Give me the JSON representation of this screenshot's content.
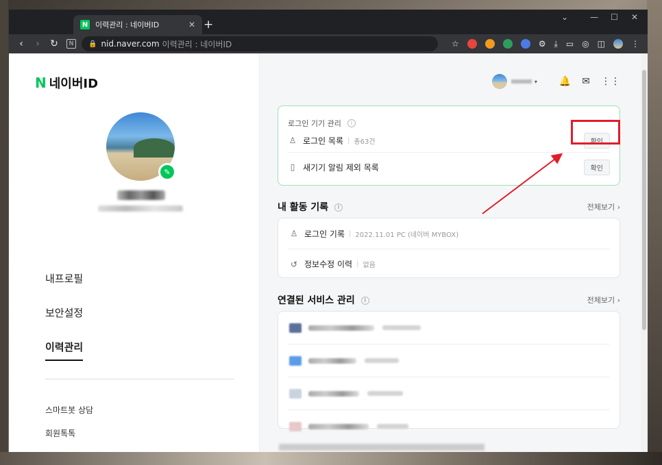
{
  "browser": {
    "tab_title": "이력관리 : 네이버ID",
    "tab_favicon": "N",
    "new_tab": "+",
    "url_host": "nid.naver.com",
    "url_title": "이력관리 : 네이버ID",
    "controls": {
      "dropdown": "⌄",
      "minimize": "—",
      "maximize": "☐",
      "close": "✕"
    }
  },
  "sidebar": {
    "brand_n": "N",
    "brand_text": "네이버ID",
    "menu": [
      {
        "label": "내프로필"
      },
      {
        "label": "보안설정"
      },
      {
        "label": "이력관리",
        "active": true
      }
    ],
    "sub_menu": [
      {
        "label": "스마트봇 상담"
      },
      {
        "label": "회원톡톡"
      }
    ]
  },
  "login_devices": {
    "title": "로그인 기기 관리",
    "rows": [
      {
        "icon": "user-key-icon",
        "label": "로그인 목록",
        "meta": "총63건",
        "button": "확인"
      },
      {
        "icon": "phone-icon",
        "label": "새기기 알림 제외 목록",
        "meta": "",
        "button": "확인"
      }
    ]
  },
  "activity": {
    "title": "내 활동 기록",
    "see_all": "전체보기 ›",
    "rows": [
      {
        "icon": "user-key-icon",
        "label": "로그인 기록",
        "meta": "2022.11.01 PC (네이버 MYBOX)"
      },
      {
        "icon": "history-icon",
        "label": "정보수정 이력",
        "meta": "없음"
      }
    ]
  },
  "connected": {
    "title": "연결된 서비스 관리",
    "see_all": "전체보기 ›"
  },
  "colors": {
    "brand_green": "#03c75a",
    "highlight_red": "#e11d2a",
    "page_bg": "#f5f6f7"
  }
}
